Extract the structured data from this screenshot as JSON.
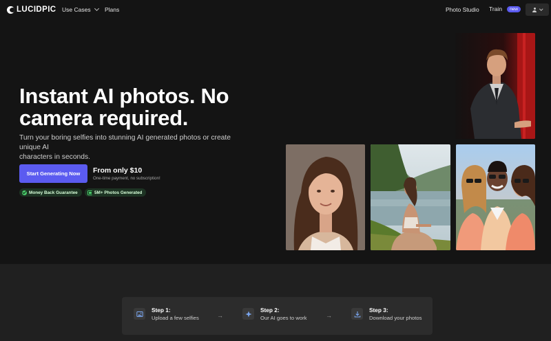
{
  "nav": {
    "logo": "LUCIDPIC",
    "use_cases": "Use Cases",
    "plans": "Plans",
    "photo_studio": "Photo Studio",
    "train": "Train",
    "train_badge": "new"
  },
  "hero": {
    "title_line1": "Instant AI photos. No",
    "title_line2": "camera required.",
    "subtitle_line1": "Turn your boring selfies into stunning AI generated photos or create unique AI",
    "subtitle_line2": "characters in seconds.",
    "cta": "Start Generating Now",
    "price": "From only $10",
    "price_note": "One-time payment, no subscription!",
    "badges": [
      "Money Back Guarantee",
      "5M+ Photos Generated"
    ]
  },
  "steps": [
    {
      "title": "Step 1:",
      "text": "Upload a few selfies",
      "icon": "image-icon"
    },
    {
      "title": "Step 2:",
      "text": "Our AI goes to work",
      "icon": "sparkle-icon"
    },
    {
      "title": "Step 3:",
      "text": "Download your photos",
      "icon": "download-icon"
    }
  ],
  "arrow": "→",
  "colors": {
    "background": "#141414",
    "accent": "#5b5bf0",
    "badge_bg": "#1d3323",
    "badge_icon": "#4ac86a",
    "lower_bg": "#202020",
    "steps_bg": "#2c2c2c"
  },
  "images": [
    "man-speaking-on-stage-photo",
    "woman-portrait-photo",
    "woman-meditating-by-lake-photo",
    "friends-group-selfie-photo"
  ]
}
